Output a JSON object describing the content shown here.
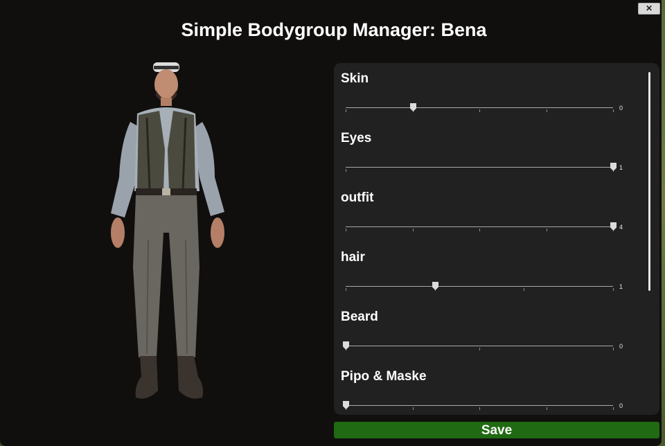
{
  "window": {
    "title": "Simple Bodygroup Manager: Bena",
    "close_label": "✕"
  },
  "bodygroups": [
    {
      "label": "Skin",
      "value": "0",
      "steps": 5,
      "position": 0.25
    },
    {
      "label": "Eyes",
      "value": "1",
      "steps": 2,
      "position": 1.0
    },
    {
      "label": "outfit",
      "value": "4",
      "steps": 5,
      "position": 1.0
    },
    {
      "label": "hair",
      "value": "1",
      "steps": 4,
      "position": 0.333
    },
    {
      "label": "Beard",
      "value": "0",
      "steps": 3,
      "position": 0.0
    },
    {
      "label": "Pipo & Maske",
      "value": "0",
      "steps": 5,
      "position": 0.0
    }
  ],
  "footer": {
    "save_label": "Save"
  },
  "colors": {
    "window_bg": "#100f0d",
    "panel_bg": "#212121",
    "save_green": "#1f6a12"
  }
}
